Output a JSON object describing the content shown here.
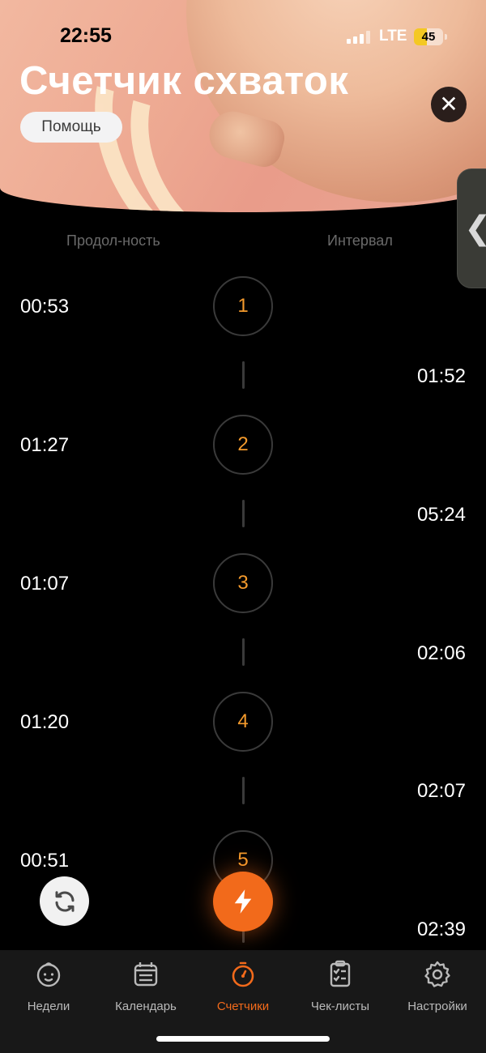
{
  "status_bar": {
    "time": "22:55",
    "network": "LTE",
    "battery": "45"
  },
  "header": {
    "title": "Счетчик схваток",
    "help_label": "Помощь",
    "close_icon": "close-icon"
  },
  "columns": {
    "duration_label": "Продол-ность",
    "interval_label": "Интервал"
  },
  "contractions": [
    {
      "number": "1",
      "duration": "00:53",
      "interval": "01:52"
    },
    {
      "number": "2",
      "duration": "01:27",
      "interval": "05:24"
    },
    {
      "number": "3",
      "duration": "01:07",
      "interval": "02:06"
    },
    {
      "number": "4",
      "duration": "01:20",
      "interval": "02:07"
    },
    {
      "number": "5",
      "duration": "00:51",
      "interval": "02:39"
    }
  ],
  "actions": {
    "refresh_icon": "refresh-icon",
    "start_icon": "lightning-icon"
  },
  "tabbar": {
    "items": [
      {
        "label": "Недели",
        "icon": "baby-face-icon"
      },
      {
        "label": "Календарь",
        "icon": "calendar-icon"
      },
      {
        "label": "Счетчики",
        "icon": "stopwatch-icon",
        "active": true
      },
      {
        "label": "Чек-листы",
        "icon": "checklist-icon"
      },
      {
        "label": "Настройки",
        "icon": "gear-icon"
      }
    ]
  },
  "colors": {
    "accent": "#f26a1b",
    "number": "#f39a2c",
    "background": "#000000",
    "tabbar": "#181818"
  }
}
